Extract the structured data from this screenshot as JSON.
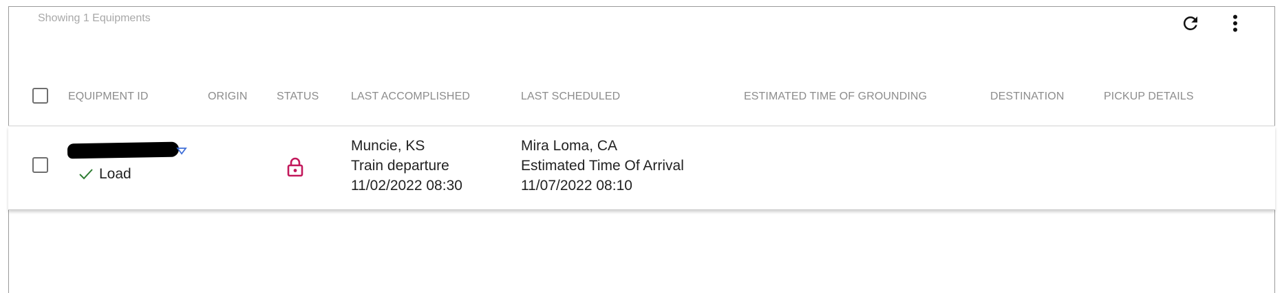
{
  "summary": {
    "showing_text": "Showing 1 Equipments"
  },
  "toolbar": {
    "refresh_icon": "refresh-icon",
    "more_icon": "more-vertical-icon"
  },
  "table": {
    "columns": [
      "EQUIPMENT ID",
      "ORIGIN",
      "STATUS",
      "LAST ACCOMPLISHED",
      "LAST SCHEDULED",
      "ESTIMATED TIME OF GROUNDING",
      "DESTINATION",
      "PICKUP DETAILS"
    ],
    "rows": [
      {
        "equipment_id": "",
        "load_status": "Load",
        "status_icon": "lock-icon",
        "last_accomplished": {
          "location": "Muncie, KS",
          "event": "Train departure",
          "datetime": "11/02/2022 08:30"
        },
        "last_scheduled": {
          "location": "Mira Loma, CA",
          "event": "Estimated Time Of Arrival",
          "datetime": "11/07/2022 08:10"
        }
      }
    ]
  },
  "colors": {
    "lock": "#c2185b",
    "check": "#2e7d32",
    "caret": "#3f6fd8"
  }
}
